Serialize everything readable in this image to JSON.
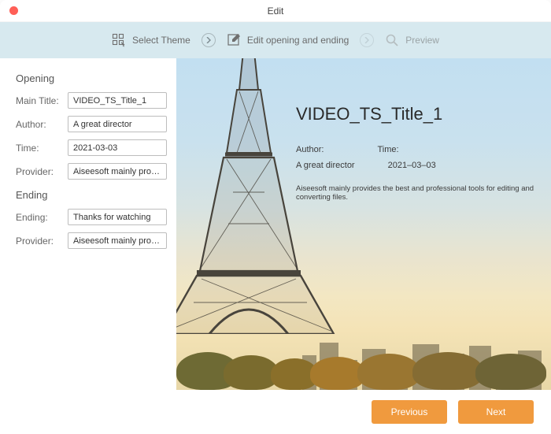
{
  "window": {
    "title": "Edit"
  },
  "steps": {
    "select_theme": "Select Theme",
    "edit_opening": "Edit opening and ending",
    "preview": "Preview"
  },
  "form": {
    "opening_header": "Opening",
    "main_title_label": "Main Title:",
    "main_title_value": "VIDEO_TS_Title_1",
    "author_label": "Author:",
    "author_value": "A great director",
    "time_label": "Time:",
    "time_value": "2021-03-03",
    "provider_label": "Provider:",
    "provider_value": "Aiseesoft mainly provides the best and professional tools for editing and converting files.",
    "ending_header": "Ending",
    "ending_label": "Ending:",
    "ending_value": "Thanks for watching",
    "ending_provider_label": "Provider:",
    "ending_provider_value": "Aiseesoft mainly provides the best and professional tools for editing and converting files."
  },
  "preview": {
    "title": "VIDEO_TS_Title_1",
    "author_label": "Author:",
    "time_label": "Time:",
    "author_value": "A great director",
    "time_value": "2021–03–03",
    "description": "Aiseesoft mainly provides the best and professional tools for editing and converting files."
  },
  "footer": {
    "previous": "Previous",
    "next": "Next"
  }
}
